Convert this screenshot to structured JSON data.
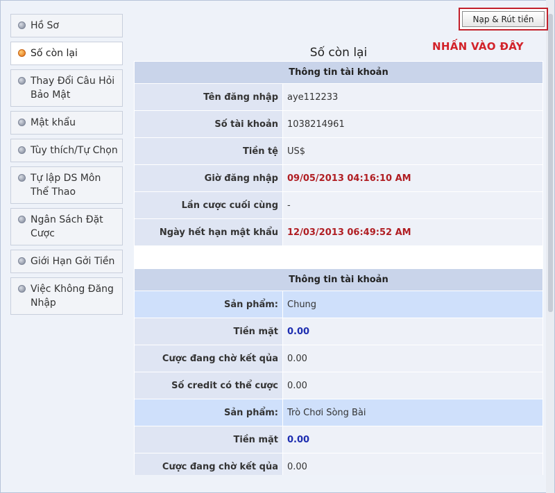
{
  "sidebar": {
    "items": [
      {
        "label": "Hồ Sơ"
      },
      {
        "label": "Số còn lại"
      },
      {
        "label": "Thay Đổi Câu Hỏi Bảo Mật"
      },
      {
        "label": "Mật khẩu"
      },
      {
        "label": "Tùy thích/Tự Chọn"
      },
      {
        "label": "Tự lập DS Môn Thể Thao"
      },
      {
        "label": "Ngân Sách Đặt Cược"
      },
      {
        "label": "Giới Hạn Gởi Tiền"
      },
      {
        "label": "Việc Không Đăng Nhập"
      }
    ]
  },
  "header": {
    "deposit_button": "Nạp & Rút tiền",
    "annotation": "NHẤN VÀO ĐÂY",
    "title": "Số còn lại"
  },
  "account": {
    "heading": "Thông tin tài khoản",
    "rows": [
      {
        "label": "Tên đăng nhập",
        "value": "aye112233"
      },
      {
        "label": "Số tài khoản",
        "value": "1038214961"
      },
      {
        "label": "Tiền tệ",
        "value": "US$"
      },
      {
        "label": "Giờ đăng nhập",
        "value": "09/05/2013 04:16:10 AM"
      },
      {
        "label": "Lần cược cuối cùng",
        "value": "-"
      },
      {
        "label": "Ngày hết hạn mật khẩu",
        "value": "12/03/2013 06:49:52 AM"
      }
    ]
  },
  "balance": {
    "heading": "Thông tin tài khoản",
    "rows": [
      {
        "label": "Sản phẩm:",
        "value": "Chung"
      },
      {
        "label": "Tiền mặt",
        "value": "0.00"
      },
      {
        "label": "Cược đang chờ kết qủa",
        "value": "0.00"
      },
      {
        "label": "Số credit có thể cược",
        "value": "0.00"
      },
      {
        "label": "Sản phẩm:",
        "value": "Trò Chơi Sòng Bài"
      },
      {
        "label": "Tiền mặt",
        "value": "0.00"
      },
      {
        "label": "Cược đang chờ kết qủa",
        "value": "0.00"
      }
    ]
  },
  "colors": {
    "red_value": "#b01e23",
    "blue_value": "#1d2db0",
    "header_bg": "#c9d4ea",
    "product_row_bg": "#cfe0fb",
    "annotation": "#d2232a"
  }
}
